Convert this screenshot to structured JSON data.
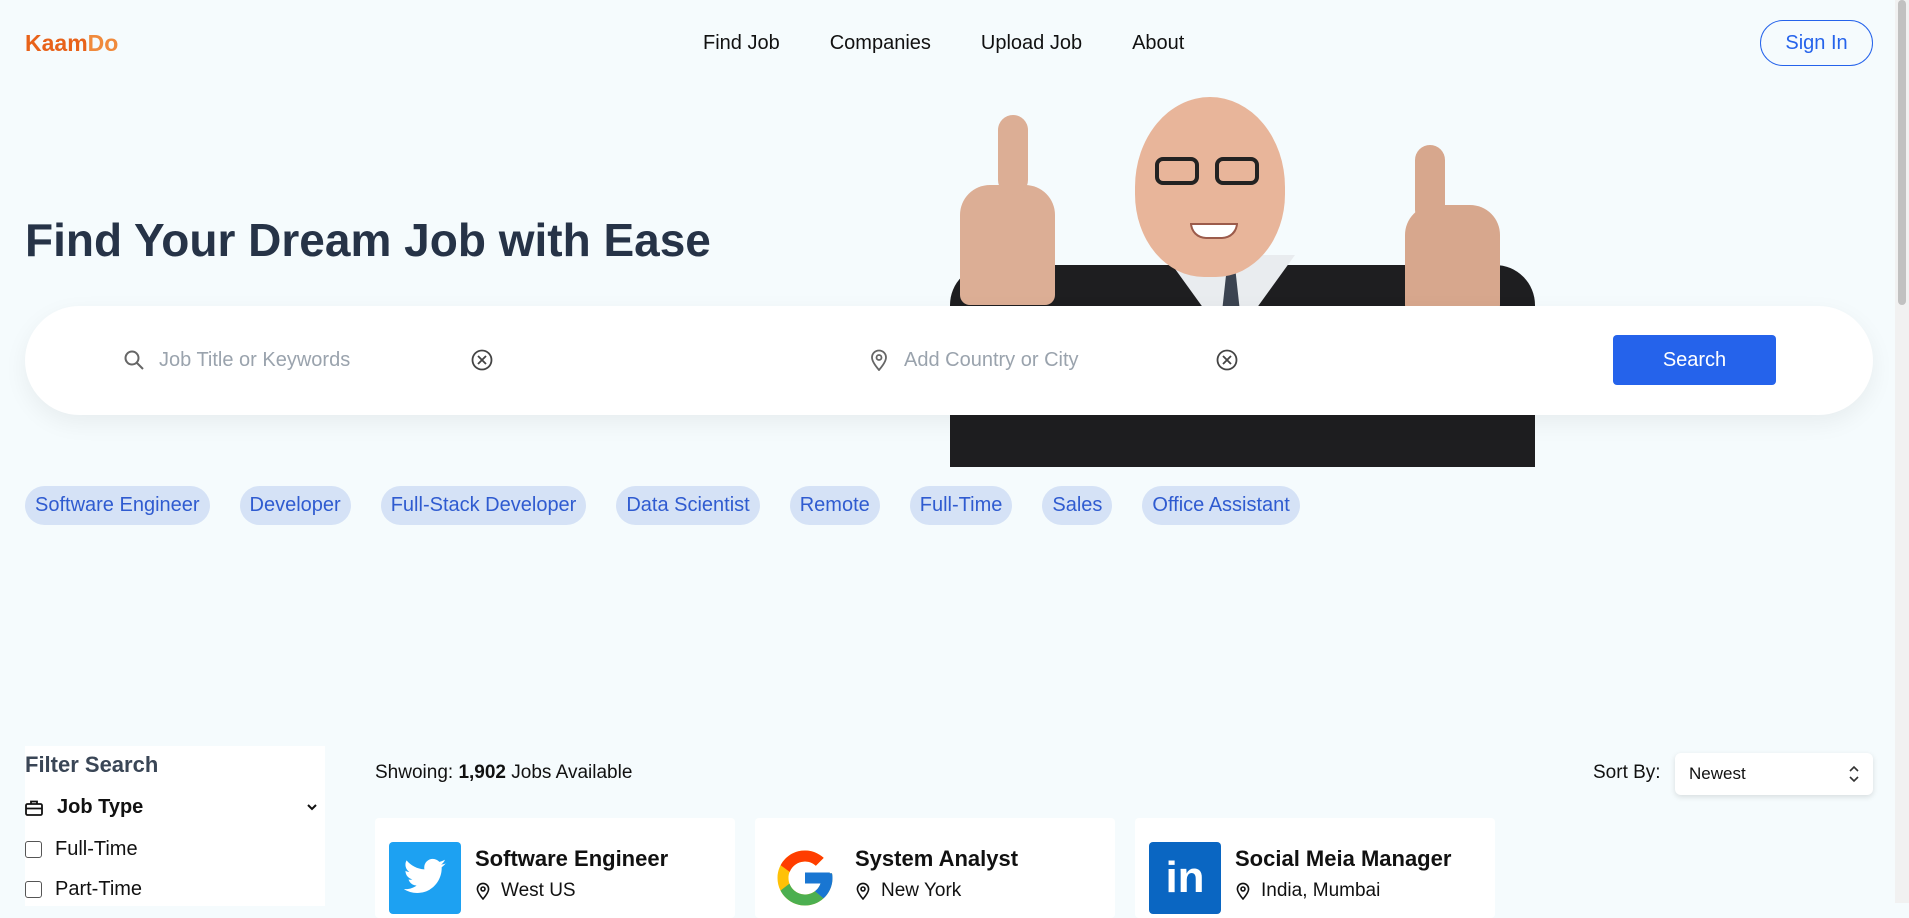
{
  "brand": {
    "part1": "Kaam",
    "part2": "Do"
  },
  "nav": {
    "items": [
      "Find Job",
      "Companies",
      "Upload Job",
      "About"
    ]
  },
  "signin_label": "Sign In",
  "hero": {
    "title": "Find Your Dream Job with Ease"
  },
  "search": {
    "keyword_placeholder": "Job Title or Keywords",
    "location_placeholder": "Add Country or City",
    "button_label": "Search"
  },
  "chips": [
    "Software Engineer",
    "Developer",
    "Full-Stack Developer",
    "Data Scientist",
    "Remote",
    "Full-Time",
    "Sales",
    "Office Assistant"
  ],
  "filter": {
    "title": "Filter Search",
    "section": "Job Type",
    "options": [
      "Full-Time",
      "Part-Time"
    ]
  },
  "results": {
    "prefix": "Shwoing: ",
    "count": "1,902",
    "suffix": " Jobs Available",
    "sort_label": "Sort By:",
    "sort_value": "Newest"
  },
  "jobs": [
    {
      "title": "Software Engineer",
      "location": "West US",
      "company_icon": "twitter-icon",
      "color": "#1da1f2"
    },
    {
      "title": "System Analyst",
      "location": "New York",
      "company_icon": "google-icon",
      "color": "#ffffff"
    },
    {
      "title": "Social Meia Manager",
      "location": "India, Mumbai",
      "company_icon": "linkedin-icon",
      "color": "#0a66c2"
    }
  ],
  "colors": {
    "accent": "#2563eb",
    "brand": "#e8621a",
    "chip_bg": "#d5e2f6",
    "heading": "#263347"
  }
}
